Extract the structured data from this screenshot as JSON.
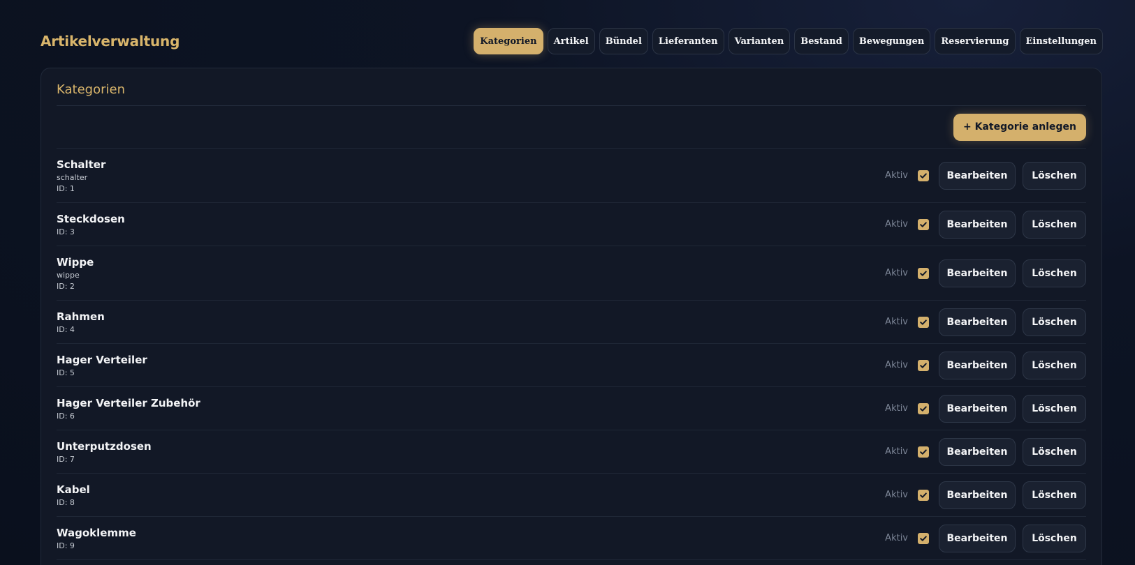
{
  "app": {
    "title": "Artikelverwaltung"
  },
  "tabs": [
    {
      "label": "Kategorien",
      "active": true
    },
    {
      "label": "Artikel"
    },
    {
      "label": "Bündel"
    },
    {
      "label": "Lieferanten"
    },
    {
      "label": "Varianten"
    },
    {
      "label": "Bestand"
    },
    {
      "label": "Bewegungen"
    },
    {
      "label": "Reservierung"
    },
    {
      "label": "Einstellungen"
    }
  ],
  "panel": {
    "title": "Kategorien",
    "add_label": "+ Kategorie anlegen",
    "aktiv_label": "Aktiv",
    "edit_label": "Bearbeiten",
    "delete_label": "Löschen"
  },
  "categories": [
    {
      "name": "Schalter",
      "slug": "schalter",
      "id": "ID: 1",
      "active": true
    },
    {
      "name": "Steckdosen",
      "id": "ID: 3",
      "active": true
    },
    {
      "name": "Wippe",
      "slug": "wippe",
      "id": "ID: 2",
      "active": true
    },
    {
      "name": "Rahmen",
      "id": "ID: 4",
      "active": true
    },
    {
      "name": "Hager Verteiler",
      "id": "ID: 5",
      "active": true
    },
    {
      "name": "Hager Verteiler Zubehör",
      "id": "ID: 6",
      "active": true
    },
    {
      "name": "Unterputzdosen",
      "id": "ID: 7",
      "active": true
    },
    {
      "name": "Kabel",
      "id": "ID: 8",
      "active": true
    },
    {
      "name": "Wagoklemme",
      "id": "ID: 9",
      "active": true
    }
  ],
  "colors": {
    "accent": "#d4b06c",
    "background": "#0b1120",
    "panel": "#121826"
  }
}
